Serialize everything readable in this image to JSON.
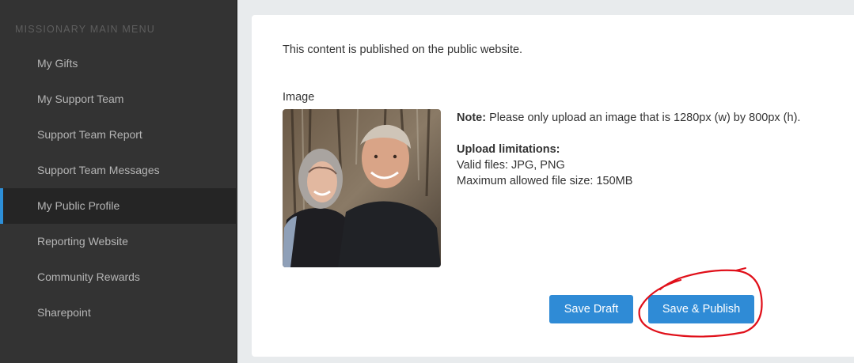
{
  "sidebar": {
    "heading": "MISSIONARY MAIN MENU",
    "items": [
      {
        "label": "My Gifts"
      },
      {
        "label": "My Support Team"
      },
      {
        "label": "Support Team Report"
      },
      {
        "label": "Support Team Messages"
      },
      {
        "label": "My Public Profile",
        "active": true
      },
      {
        "label": "Reporting Website"
      },
      {
        "label": "Community Rewards"
      },
      {
        "label": "Sharepoint"
      }
    ]
  },
  "content": {
    "intro": "This content is published on the public website.",
    "image_label": "Image",
    "note_label": "Note:",
    "note_text": "Please only upload an image that is 1280px (w) by 800px (h).",
    "limits_heading": "Upload limitations:",
    "valid_files": "Valid files: JPG, PNG",
    "max_size": "Maximum allowed file size: 150MB"
  },
  "buttons": {
    "save_draft": "Save Draft",
    "save_publish": "Save & Publish"
  },
  "colors": {
    "sidebar_bg": "#333333",
    "active_accent": "#2d8fd8",
    "button_blue": "#2f8bd6",
    "annotation_red": "#e0101a"
  }
}
